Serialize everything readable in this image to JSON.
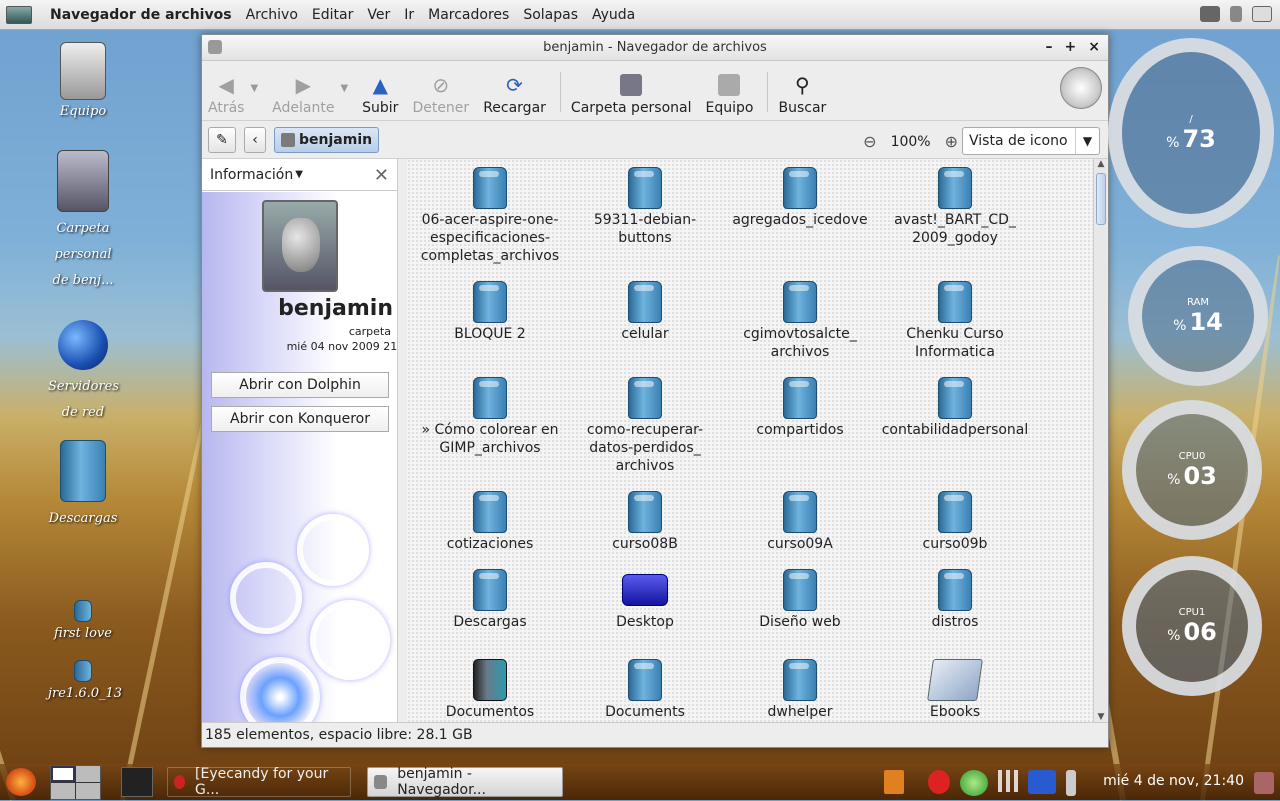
{
  "top_panel": {
    "app_title": "Navegador de archivos",
    "menus": [
      "Archivo",
      "Editar",
      "Ver",
      "Ir",
      "Marcadores",
      "Solapas",
      "Ayuda"
    ]
  },
  "desktop_icons": [
    {
      "label": "Equipo"
    },
    {
      "label": "Carpeta personal de benj..."
    },
    {
      "label": "Servidores de red"
    },
    {
      "label": "Descargas"
    },
    {
      "label": "first love"
    },
    {
      "label": "jre1.6.0_13"
    }
  ],
  "window": {
    "title": "benjamin - Navegador de archivos",
    "controls": [
      "–",
      "+",
      "×"
    ],
    "toolbar": {
      "back": "Atrás",
      "forward": "Adelante",
      "up": "Subir",
      "stop": "Detener",
      "reload": "Recargar",
      "home": "Carpeta personal",
      "computer": "Equipo",
      "search": "Buscar"
    },
    "location": {
      "crumb": "benjamin",
      "zoom": "100%",
      "view_mode": "Vista de icono"
    },
    "side_pane": {
      "mode": "Información",
      "name": "benjamin",
      "kind": "carpeta",
      "date": "mié 04 nov 2009 21:",
      "open_dolphin": "Abrir con Dolphin",
      "open_konqueror": "Abrir con Konqueror"
    },
    "files": [
      {
        "name": "06-acer-aspire-one-especificaciones-completas_archivos",
        "lines": [
          "06-acer-aspire-one-",
          "especificaciones-",
          "completas_archivos"
        ],
        "type": "folder"
      },
      {
        "name": "59311-debian-buttons",
        "lines": [
          "59311-debian-",
          "buttons"
        ],
        "type": "folder"
      },
      {
        "name": "agregados_icedove",
        "lines": [
          "agregados_icedove"
        ],
        "type": "folder"
      },
      {
        "name": "avast!_BART_CD_2009_godoy",
        "lines": [
          "avast!_BART_CD_",
          "2009_godoy"
        ],
        "type": "folder"
      },
      {
        "name": "BLOQUE 2",
        "lines": [
          "BLOQUE 2"
        ],
        "type": "folder"
      },
      {
        "name": "celular",
        "lines": [
          "celular"
        ],
        "type": "folder"
      },
      {
        "name": "cgimovtosalcte_archivos",
        "lines": [
          "cgimovtosalcte_",
          "archivos"
        ],
        "type": "folder"
      },
      {
        "name": "Chenku Curso Informatica",
        "lines": [
          "Chenku Curso",
          "Informatica"
        ],
        "type": "folder"
      },
      {
        "name": "» Cómo colorear en GIMP_archivos",
        "lines": [
          "» Cómo colorear en",
          "GIMP_archivos"
        ],
        "type": "folder"
      },
      {
        "name": "como-recuperar-datos-perdidos_archivos",
        "lines": [
          "como-recuperar-",
          "datos-perdidos_",
          "archivos"
        ],
        "type": "folder"
      },
      {
        "name": "compartidos",
        "lines": [
          "compartidos"
        ],
        "type": "folder"
      },
      {
        "name": "contabilidadpersonal",
        "lines": [
          "contabilidadpersonal"
        ],
        "type": "folder"
      },
      {
        "name": "cotizaciones",
        "lines": [
          "cotizaciones"
        ],
        "type": "folder"
      },
      {
        "name": "curso08B",
        "lines": [
          "curso08B"
        ],
        "type": "folder"
      },
      {
        "name": "curso09A",
        "lines": [
          "curso09A"
        ],
        "type": "folder"
      },
      {
        "name": "curso09b",
        "lines": [
          "curso09b"
        ],
        "type": "folder"
      },
      {
        "name": "Descargas",
        "lines": [
          "Descargas"
        ],
        "type": "folder"
      },
      {
        "name": "Desktop",
        "lines": [
          "Desktop"
        ],
        "type": "desktop"
      },
      {
        "name": "Diseño web",
        "lines": [
          "Diseño web"
        ],
        "type": "folder"
      },
      {
        "name": "distros",
        "lines": [
          "distros"
        ],
        "type": "folder"
      },
      {
        "name": "Documentos",
        "lines": [
          "Documentos"
        ],
        "type": "documents"
      },
      {
        "name": "Documents",
        "lines": [
          "Documents"
        ],
        "type": "folder"
      },
      {
        "name": "dwhelper",
        "lines": [
          "dwhelper"
        ],
        "type": "folder"
      },
      {
        "name": "Ebooks",
        "lines": [
          "Ebooks"
        ],
        "type": "ebook"
      }
    ],
    "status": "185 elementos, espacio libre: 28.1 GB"
  },
  "gauges": [
    {
      "label": "/",
      "value": "73",
      "unit": "%"
    },
    {
      "label": "RAM",
      "value": "14",
      "unit": "%"
    },
    {
      "label": "CPU0",
      "value": "03",
      "unit": "%"
    },
    {
      "label": "CPU1",
      "value": "06",
      "unit": "%"
    }
  ],
  "taskbar": {
    "tasks": [
      "[Eyecandy for your G...",
      "benjamin - Navegador..."
    ],
    "clock": "mié  4 de nov, 21:40"
  }
}
